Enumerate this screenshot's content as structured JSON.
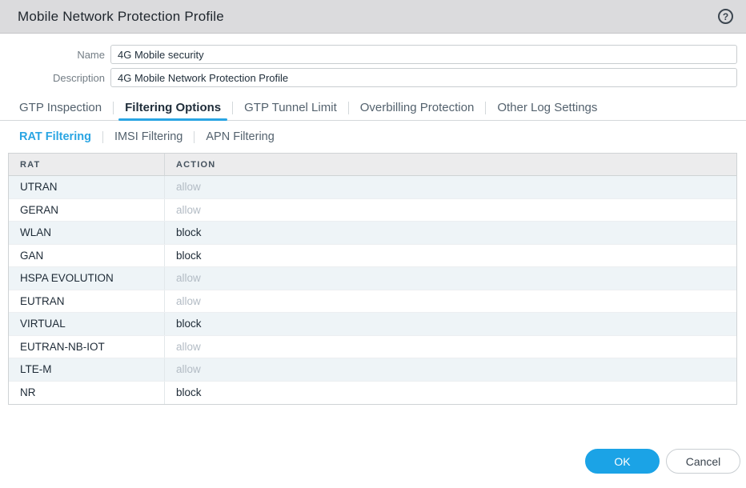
{
  "dialog": {
    "title": "Mobile Network Protection Profile",
    "help_glyph": "?"
  },
  "form": {
    "name": {
      "label": "Name",
      "value": "4G Mobile security"
    },
    "description": {
      "label": "Description",
      "value": "4G Mobile Network Protection Profile"
    }
  },
  "tabs": [
    {
      "label": "GTP Inspection",
      "active": false
    },
    {
      "label": "Filtering Options",
      "active": true
    },
    {
      "label": "GTP Tunnel Limit",
      "active": false
    },
    {
      "label": "Overbilling Protection",
      "active": false
    },
    {
      "label": "Other Log Settings",
      "active": false
    }
  ],
  "subtabs": [
    {
      "label": "RAT Filtering",
      "active": true
    },
    {
      "label": "IMSI Filtering",
      "active": false
    },
    {
      "label": "APN Filtering",
      "active": false
    }
  ],
  "table": {
    "columns": {
      "rat": "RAT",
      "action": "ACTION"
    },
    "rows": [
      {
        "rat": "UTRAN",
        "action": "allow",
        "muted": true
      },
      {
        "rat": "GERAN",
        "action": "allow",
        "muted": true
      },
      {
        "rat": "WLAN",
        "action": "block",
        "muted": false
      },
      {
        "rat": "GAN",
        "action": "block",
        "muted": false
      },
      {
        "rat": "HSPA EVOLUTION",
        "action": "allow",
        "muted": true
      },
      {
        "rat": "EUTRAN",
        "action": "allow",
        "muted": true
      },
      {
        "rat": "VIRTUAL",
        "action": "block",
        "muted": false
      },
      {
        "rat": "EUTRAN-NB-IOT",
        "action": "allow",
        "muted": true
      },
      {
        "rat": "LTE-M",
        "action": "allow",
        "muted": true
      },
      {
        "rat": "NR",
        "action": "block",
        "muted": false
      }
    ]
  },
  "footer": {
    "ok_label": "OK",
    "cancel_label": "Cancel"
  },
  "colors": {
    "accent_blue": "#1ba3e6",
    "titlebar_bg": "#dbdbdd",
    "header_bg": "#ececed",
    "alt_row_bg": "#eef4f7",
    "muted_text": "#b3bcc5"
  }
}
